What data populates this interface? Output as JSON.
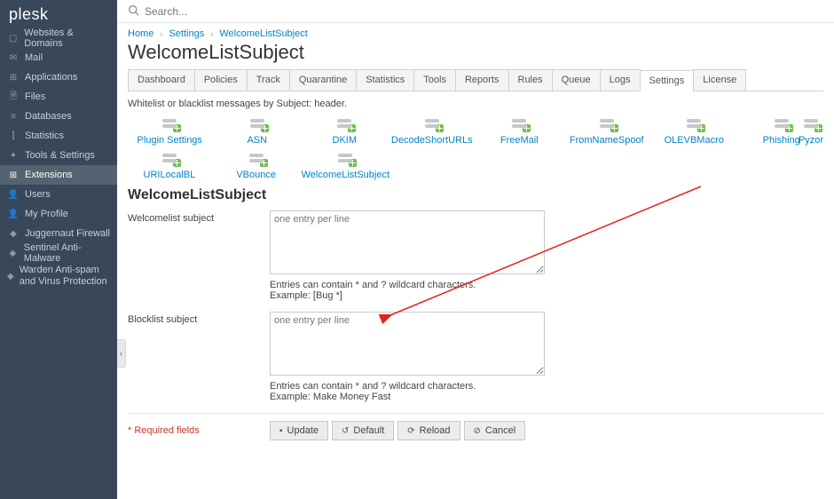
{
  "brand": "plesk",
  "search": {
    "placeholder": "Search..."
  },
  "sidebar": {
    "items": [
      {
        "label": "Websites & Domains",
        "icon": "▢"
      },
      {
        "label": "Mail",
        "icon": "✉"
      },
      {
        "label": "Applications",
        "icon": "⊞"
      },
      {
        "label": "Files",
        "icon": "🗎"
      },
      {
        "label": "Databases",
        "icon": "≡"
      },
      {
        "label": "Statistics",
        "icon": "⫿"
      },
      {
        "label": "Tools & Settings",
        "icon": "✦"
      },
      {
        "label": "Extensions",
        "icon": "⊞",
        "active": true
      },
      {
        "label": "Users",
        "icon": "👤"
      },
      {
        "label": "My Profile",
        "icon": "👤"
      },
      {
        "label": "Juggernaut Firewall",
        "icon": "◆"
      },
      {
        "label": "Sentinel Anti-Malware",
        "icon": "◆"
      },
      {
        "label": "Warden Anti-spam and Virus Protection",
        "icon": "◆",
        "wrap": true
      }
    ]
  },
  "breadcrumbs": [
    {
      "label": "Home"
    },
    {
      "label": "Settings"
    },
    {
      "label": "WelcomeListSubject"
    }
  ],
  "page_title": "WelcomeListSubject",
  "tabs": [
    "Dashboard",
    "Policies",
    "Track",
    "Quarantine",
    "Statistics",
    "Tools",
    "Reports",
    "Rules",
    "Queue",
    "Logs",
    "Settings",
    "License"
  ],
  "active_tab": "Settings",
  "description": "Whitelist or blacklist messages by Subject: header.",
  "plugins_row1": [
    "Plugin Settings",
    "ASN",
    "DKIM",
    "DecodeShortURLs",
    "FreeMail",
    "FromNameSpoof",
    "OLEVBMacro",
    "Phishing"
  ],
  "plugin_row1_extra": "Pyzor",
  "plugins_row2": [
    "URILocalBL",
    "VBounce",
    "WelcomeListSubject"
  ],
  "section_title": "WelcomeListSubject",
  "form": {
    "welcomelist": {
      "label": "Welcomelist subject",
      "placeholder": "one entry per line",
      "help1": "Entries can contain * and ? wildcard characters.",
      "help2": "Example: [Bug *]"
    },
    "blocklist": {
      "label": "Blocklist subject",
      "placeholder": "one entry per line",
      "help1": "Entries can contain * and ? wildcard characters.",
      "help2": "Example: Make Money Fast"
    }
  },
  "required_label": "* Required fields",
  "buttons": {
    "update": "Update",
    "default": "Default",
    "reload": "Reload",
    "cancel": "Cancel"
  },
  "collapse_handle": "‹"
}
